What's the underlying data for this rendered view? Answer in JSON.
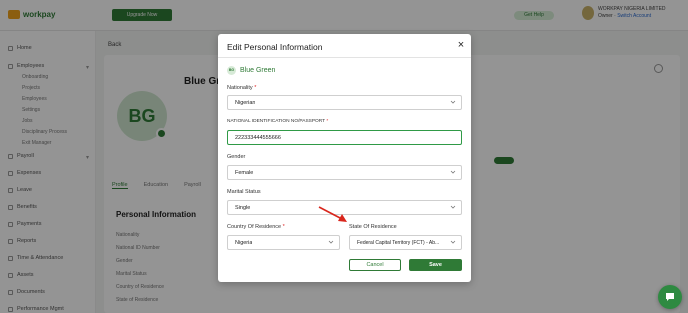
{
  "background": {
    "logo_text": "workpay",
    "top_action_label": "Upgrade Now",
    "top_pill_label": "Get Help",
    "user": {
      "org": "WORKPAY NIGERIA LIMITED",
      "role": "Owner",
      "link": "Switch Account"
    },
    "sidebar": [
      {
        "label": "Home"
      },
      {
        "label": "Employees"
      },
      {
        "label": "Payroll"
      },
      {
        "label": "Expenses"
      },
      {
        "label": "Leave"
      },
      {
        "label": "Benefits"
      },
      {
        "label": "Payments"
      },
      {
        "label": "Reports"
      },
      {
        "label": "Time & Attendance"
      },
      {
        "label": "Assets"
      },
      {
        "label": "Documents"
      },
      {
        "label": "Performance Mgmt"
      }
    ],
    "employee_subitems": [
      "Onboarding",
      "Projects",
      "Employees",
      "Settings",
      "Jobs",
      "Disciplinary Process",
      "Exit Manager"
    ],
    "page_title": "Back",
    "employee_name": "Blue Green",
    "avatar_initials": "BG",
    "tabs": [
      "Profile",
      "Education",
      "Payroll"
    ],
    "section_title": "Personal Information",
    "fields": [
      "Nationality",
      "National ID Number",
      "Gender",
      "Marital Status",
      "Country of Residence",
      "State of Residence"
    ]
  },
  "modal": {
    "title": "Edit Personal Information",
    "close_label": "×",
    "person": {
      "initials": "BG",
      "name": "Blue Green"
    },
    "nationality": {
      "label": "Nationality",
      "required": "*",
      "value": "Nigerian"
    },
    "national_id": {
      "label": "NATIONAL IDENTIFICATION NO/PASSPORT",
      "required": "*",
      "value": "222333444555666"
    },
    "gender": {
      "label": "Gender",
      "value": "Female"
    },
    "marital_status": {
      "label": "Marital Status",
      "value": "Single"
    },
    "country": {
      "label": "Country Of Residence",
      "required": "*",
      "value": "Nigeria"
    },
    "state": {
      "label": "State Of Residence",
      "value": "Federal Capital Territory (FCT) - Ab..."
    },
    "cancel_label": "Cancel",
    "save_label": "Save"
  },
  "colors": {
    "brand_green": "#2f7a36",
    "focus_green": "#2f9a46",
    "arrow_red": "#d9261c",
    "required_red": "#dd2222"
  },
  "icons": {
    "close": "close-icon",
    "chevron": "chevron-down-icon",
    "chat": "chat-icon",
    "annotation": "red-arrow-annotation"
  }
}
